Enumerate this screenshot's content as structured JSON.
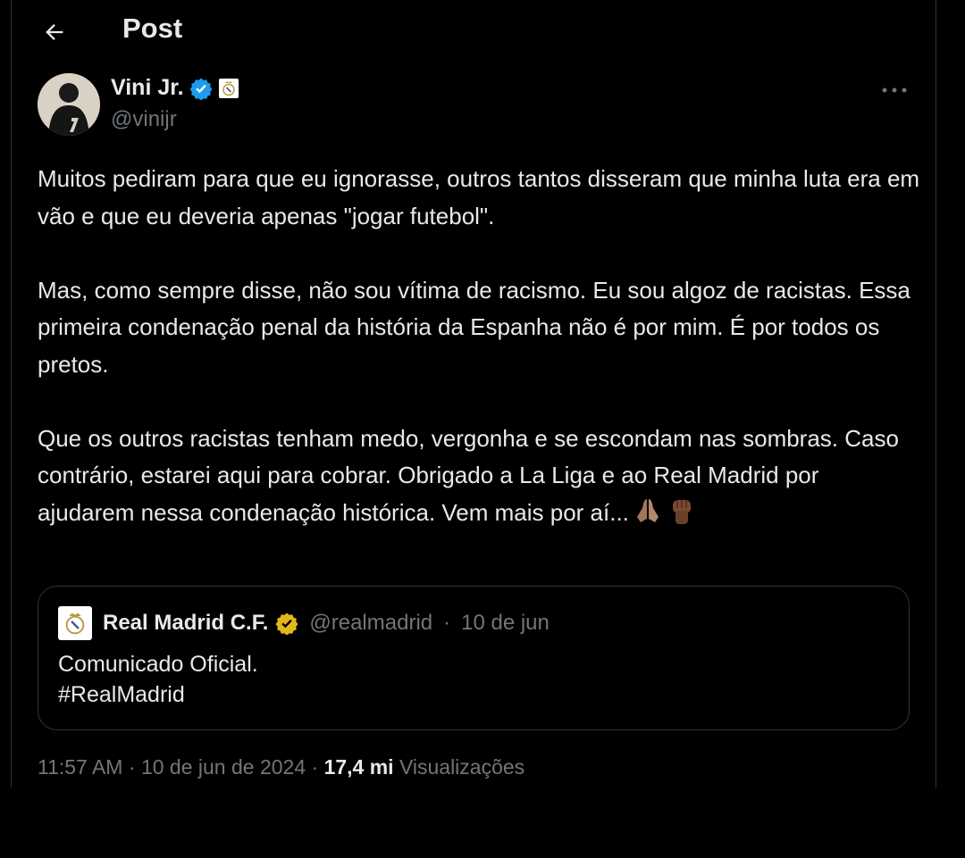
{
  "header": {
    "title": "Post",
    "back_icon": "arrow-left-icon"
  },
  "author": {
    "name": "Vini Jr.",
    "handle": "@vinijr",
    "verified_color": "#1d9bf0"
  },
  "tweet": {
    "paragraphs": [
      "Muitos pediram para que eu ignorasse, outros tantos disseram que minha luta era em vão e que eu deveria apenas \"jogar futebol\".",
      "Mas, como sempre disse, não sou vítima de racismo. Eu sou algoz de racistas. Essa primeira condenação penal da história da Espanha não é por mim. É por todos os pretos.",
      "Que os outros racistas tenham medo, vergonha e se escondam nas sombras. Caso contrário, estarei aqui para cobrar. Obrigado a La Liga e ao Real Madrid por ajudarem nessa condenação histórica. Vem mais por aí..."
    ],
    "emojis": [
      "folded-hands-emoji",
      "raised-fist-emoji"
    ]
  },
  "quote": {
    "name": "Real Madrid C.F.",
    "handle": "@realmadrid",
    "separator": "·",
    "date": "10 de jun",
    "line1": "Comunicado Oficial.",
    "line2": "#RealMadrid",
    "verified_color": "#e2b719"
  },
  "footer": {
    "time": "11:57 AM",
    "sep1": "·",
    "date": "10 de jun de 2024",
    "sep2": "·",
    "views_count": "17,4 mi",
    "views_label": "Visualizações"
  },
  "colors": {
    "background": "#000000",
    "text": "#e7e9ea",
    "muted": "#71767b",
    "border": "#2f3336"
  }
}
